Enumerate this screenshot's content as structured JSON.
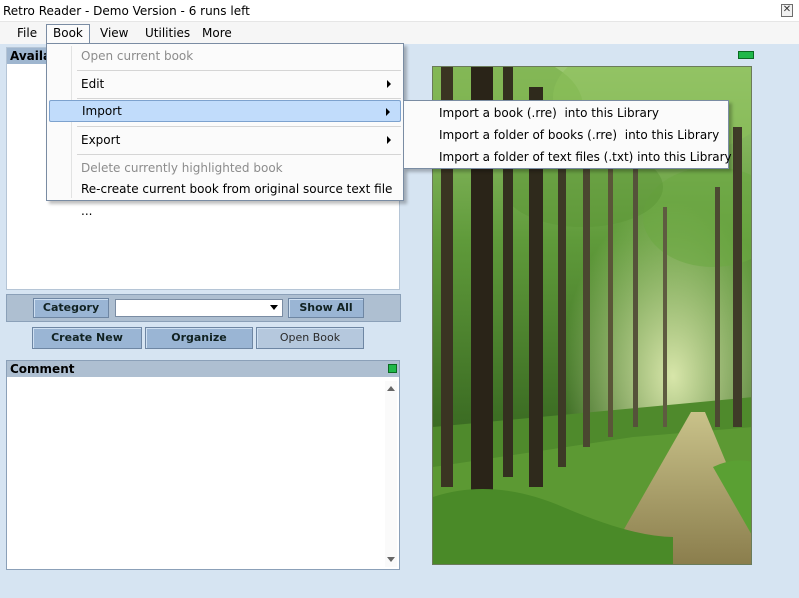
{
  "window": {
    "title": "Retro Reader - Demo Version - 6 runs left",
    "close_glyph": "✕"
  },
  "menubar": {
    "items": [
      {
        "label": "File"
      },
      {
        "label": "Book"
      },
      {
        "label": "View"
      },
      {
        "label": "Utilities"
      },
      {
        "label": "More"
      }
    ]
  },
  "library_panel": {
    "header_label": "Availa"
  },
  "category_bar": {
    "category_label": "Category",
    "select_value": "",
    "show_all_label": "Show All"
  },
  "actions": {
    "create_new_label": "Create New",
    "organize_label": "Organize",
    "open_book_label": "Open Book"
  },
  "comment_panel": {
    "header_label": "Comment"
  },
  "book_menu": {
    "items": [
      {
        "label": "Open current book",
        "enabled": false,
        "submenu": false
      },
      {
        "label": "Edit",
        "enabled": true,
        "submenu": true
      },
      {
        "label": "Import",
        "enabled": true,
        "submenu": true,
        "highlighted": true
      },
      {
        "label": "Export",
        "enabled": true,
        "submenu": true
      },
      {
        "label": "Delete currently highlighted book",
        "enabled": false,
        "submenu": false
      },
      {
        "label": "Re-create current book from original source text file ...",
        "enabled": true,
        "submenu": false
      }
    ]
  },
  "import_submenu": {
    "items": [
      {
        "label": "Import a book (.rre)  into this Library"
      },
      {
        "label": "Import a folder of books (.rre)  into this Library"
      },
      {
        "label": "Import a folder of text files (.txt) into this Library"
      }
    ]
  },
  "colors": {
    "accent": "#9ab5d4",
    "highlight": "#c1dcfb",
    "indicator_green": "#1fb84a"
  }
}
